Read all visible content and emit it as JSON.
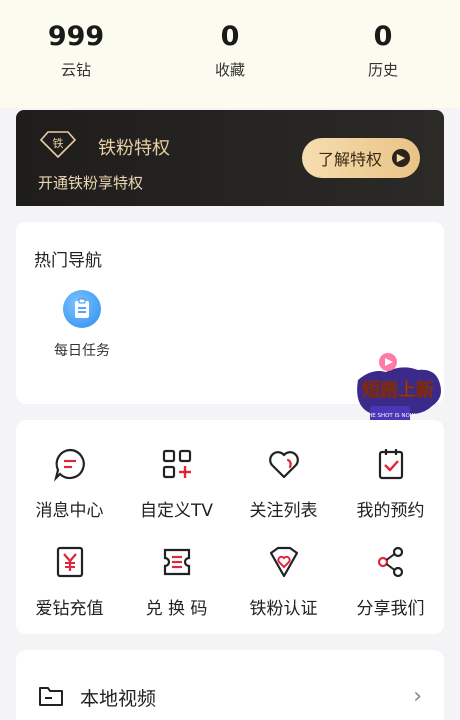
{
  "stats": [
    {
      "value": "999",
      "label": "云钻"
    },
    {
      "value": "0",
      "label": "收藏"
    },
    {
      "value": "0",
      "label": "历史"
    }
  ],
  "vip": {
    "badge_text": "铁",
    "title": "铁粉特权",
    "subtitle": "开通铁粉享特权",
    "button": "了解特权",
    "accent": "#e9cfa3"
  },
  "hot_nav": {
    "title": "热门导航",
    "items": [
      {
        "label": "每日任务",
        "icon": "clipboard-icon"
      }
    ]
  },
  "promo": {
    "text": "短剧上新",
    "sub": "THE SHOT IS NOW"
  },
  "menu": [
    {
      "label": "消息中心",
      "icon": "message-icon"
    },
    {
      "label": "自定义TV",
      "icon": "custom-tv-icon"
    },
    {
      "label": "关注列表",
      "icon": "heart-icon"
    },
    {
      "label": "我的预约",
      "icon": "reservation-icon"
    },
    {
      "label": "爱钻充值",
      "icon": "yen-icon"
    },
    {
      "label": "兑 换 码",
      "icon": "ticket-icon"
    },
    {
      "label": "铁粉认证",
      "icon": "shield-heart-icon"
    },
    {
      "label": "分享我们",
      "icon": "share-icon"
    }
  ],
  "local": {
    "label": "本地视频",
    "icon": "folder-icon"
  },
  "colors": {
    "red": "#e0263b",
    "gold": "#e8c386"
  }
}
